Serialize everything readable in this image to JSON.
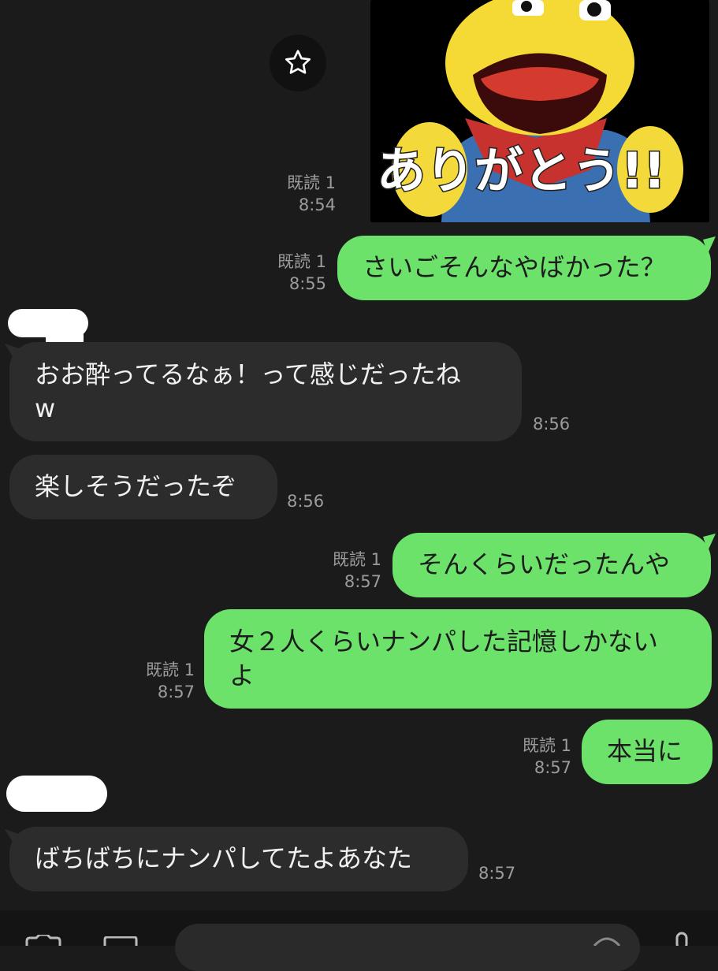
{
  "header": {
    "star_icon": "star-outline-icon"
  },
  "sticker": {
    "text": "ありがとう!!",
    "icon": "yellow-plush-character-sticker"
  },
  "messages": [
    {
      "dir": "sent",
      "read": "既読 1",
      "time": "8:54"
    },
    {
      "dir": "sent",
      "read": "既読 1",
      "time": "8:55",
      "text": "さいごそんなやばかった？"
    },
    {
      "dir": "recv",
      "time": "8:56",
      "line1": "おお酔ってるなぁ！って感じだったね",
      "line2": "w"
    },
    {
      "dir": "recv",
      "time": "8:56",
      "text": "楽しそうだったぞ"
    },
    {
      "dir": "sent",
      "read": "既読 1",
      "time": "8:57",
      "text": "そんくらいだったんや"
    },
    {
      "dir": "sent",
      "read": "既読 1",
      "time": "8:57",
      "line1": "女２人くらいナンパした記憶しかない",
      "line2": "よ"
    },
    {
      "dir": "sent",
      "read": "既読 1",
      "time": "8:57",
      "text": "本当に"
    },
    {
      "dir": "recv",
      "time": "8:57",
      "text": "ばちばちにナンパしてたよあなた"
    }
  ],
  "colors": {
    "sent_bubble": "#6ce26b",
    "recv_bubble": "#2c2c2c",
    "background": "#1b1b1b"
  }
}
